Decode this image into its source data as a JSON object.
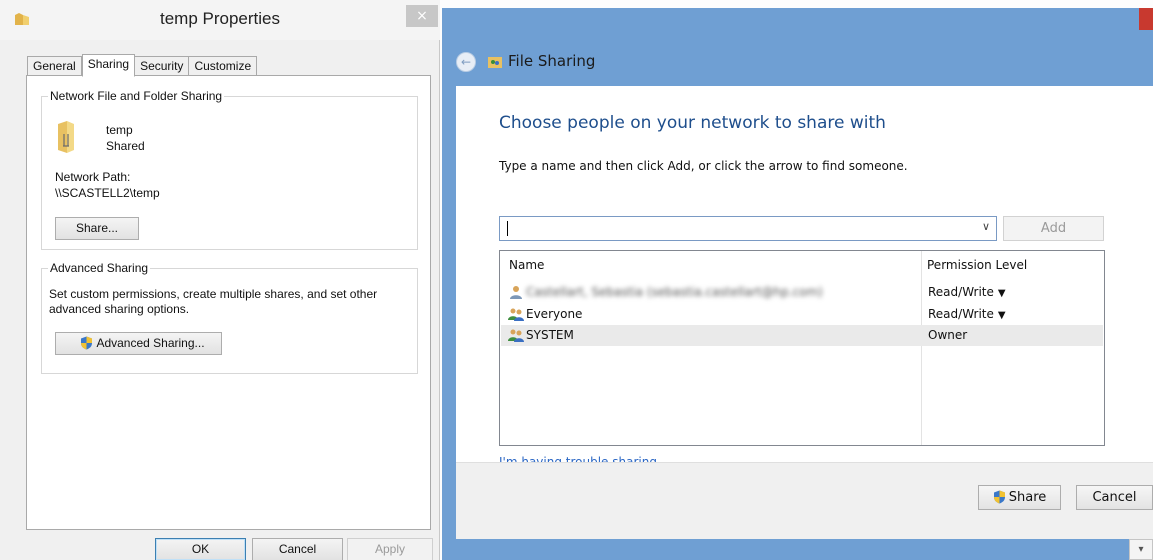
{
  "properties_dialog": {
    "title": "temp Properties",
    "close_glyph": "×",
    "tabs": [
      {
        "label": "General",
        "active": false
      },
      {
        "label": "Sharing",
        "active": true
      },
      {
        "label": "Security",
        "active": false
      },
      {
        "label": "Customize",
        "active": false
      }
    ],
    "network_sharing": {
      "legend": "Network File and Folder Sharing",
      "folder_name": "temp",
      "folder_status": "Shared",
      "network_path_label": "Network Path:",
      "network_path": "\\\\SCASTELL2\\temp",
      "share_button": "Share..."
    },
    "advanced_sharing": {
      "legend": "Advanced Sharing",
      "description_line1": "Set custom permissions, create multiple shares, and set other",
      "description_line2": "advanced sharing options.",
      "button": "Advanced Sharing..."
    },
    "footer": {
      "ok": "OK",
      "cancel": "Cancel",
      "apply": "Apply"
    }
  },
  "file_sharing": {
    "title": "File Sharing",
    "heading": "Choose people on your network to share with",
    "instruction": "Type a name and then click Add, or click the arrow to find someone.",
    "name_input_value": "",
    "dropdown_glyph": "∨",
    "add_button": "Add",
    "columns": {
      "name": "Name",
      "permission": "Permission Level"
    },
    "people": [
      {
        "name": "Castellart, Sebastia (sebastia.castellart@hp.com)",
        "permission": "Read/Write",
        "has_menu": true,
        "icon": "user-icon",
        "blurred": true
      },
      {
        "name": "Everyone",
        "permission": "Read/Write",
        "has_menu": true,
        "icon": "group-icon",
        "blurred": false
      },
      {
        "name": "SYSTEM",
        "permission": "Owner",
        "has_menu": false,
        "icon": "group-icon",
        "blurred": false
      }
    ],
    "permission_menu_glyph": "▼",
    "trouble_link": "I'm having trouble sharing",
    "share_button": "Share",
    "cancel_button": "Cancel"
  },
  "colors": {
    "window_frame": "#6f9fd3",
    "heading_blue": "#1e4e8c",
    "link_blue": "#2a66c4",
    "close_red": "#c8392f"
  }
}
